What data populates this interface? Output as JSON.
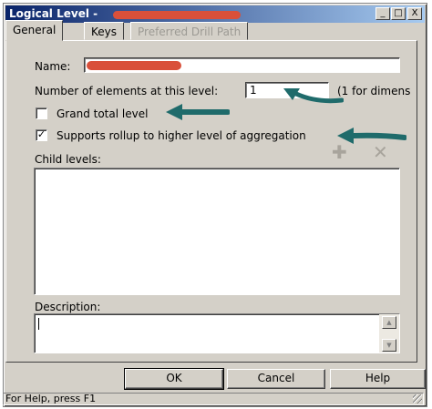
{
  "window": {
    "title": "Logical Level -",
    "caption_buttons": {
      "minimize": "_",
      "maximize": "□",
      "close": "X"
    }
  },
  "tabs": [
    {
      "label": "General",
      "active": true
    },
    {
      "label": "Keys",
      "active": false
    },
    {
      "label": "Preferred Drill Path",
      "active": false,
      "disabled": true
    }
  ],
  "form": {
    "name_label": "Name:",
    "name_value": "",
    "elements_label": "Number of elements at this level:",
    "elements_value": "1",
    "elements_hint": "(1 for dimens",
    "grand_total_label": "Grand total level",
    "grand_total_checked": false,
    "rollup_label": "Supports rollup to higher level of aggregation",
    "rollup_checked": true,
    "child_levels_label": "Child levels:",
    "description_label": "Description:",
    "description_value": ""
  },
  "icons": {
    "add": "plus-icon",
    "delete": "delete-icon",
    "annotation_arrow": "arrow-icon",
    "annotation_arrow_color": "#1f6b6b",
    "redaction_color": "#d9503a"
  },
  "buttons": {
    "ok": "OK",
    "cancel": "Cancel",
    "help": "Help"
  },
  "statusbar": {
    "text": "For Help, press F1"
  }
}
